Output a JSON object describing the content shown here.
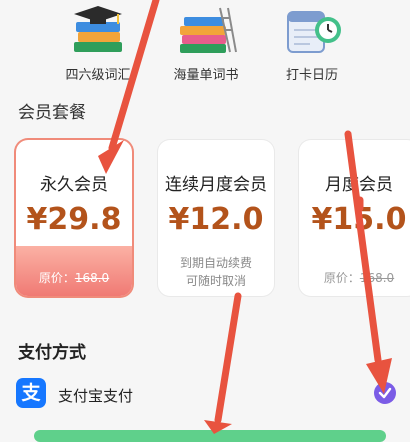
{
  "features": [
    {
      "label": "四六级词汇",
      "icon": "books-graduation-cap-icon"
    },
    {
      "label": "海量单词书",
      "icon": "books-ladder-icon"
    },
    {
      "label": "打卡日历",
      "icon": "calendar-clock-icon"
    }
  ],
  "plans_title": "会员套餐",
  "plans": [
    {
      "name": "永久会员",
      "price": "¥29.8",
      "original_label": "原价：",
      "original_price": "168.0",
      "selected": true
    },
    {
      "name": "连续月度会员",
      "price": "¥12.0",
      "note_line1": "到期自动续费",
      "note_line2": "可随时取消"
    },
    {
      "name": "月度会员",
      "price": "¥15.0",
      "original_label": "原价：",
      "original_price": "168.0"
    }
  ],
  "payment_title": "支付方式",
  "payment": {
    "label": "支付宝支付",
    "icon": "alipay-icon",
    "icon_glyph": "支",
    "selected": true
  },
  "colors": {
    "price": "#b3531b",
    "alipay": "#1677ff",
    "check": "#7b5ce6",
    "arrow": "#e8533f"
  }
}
